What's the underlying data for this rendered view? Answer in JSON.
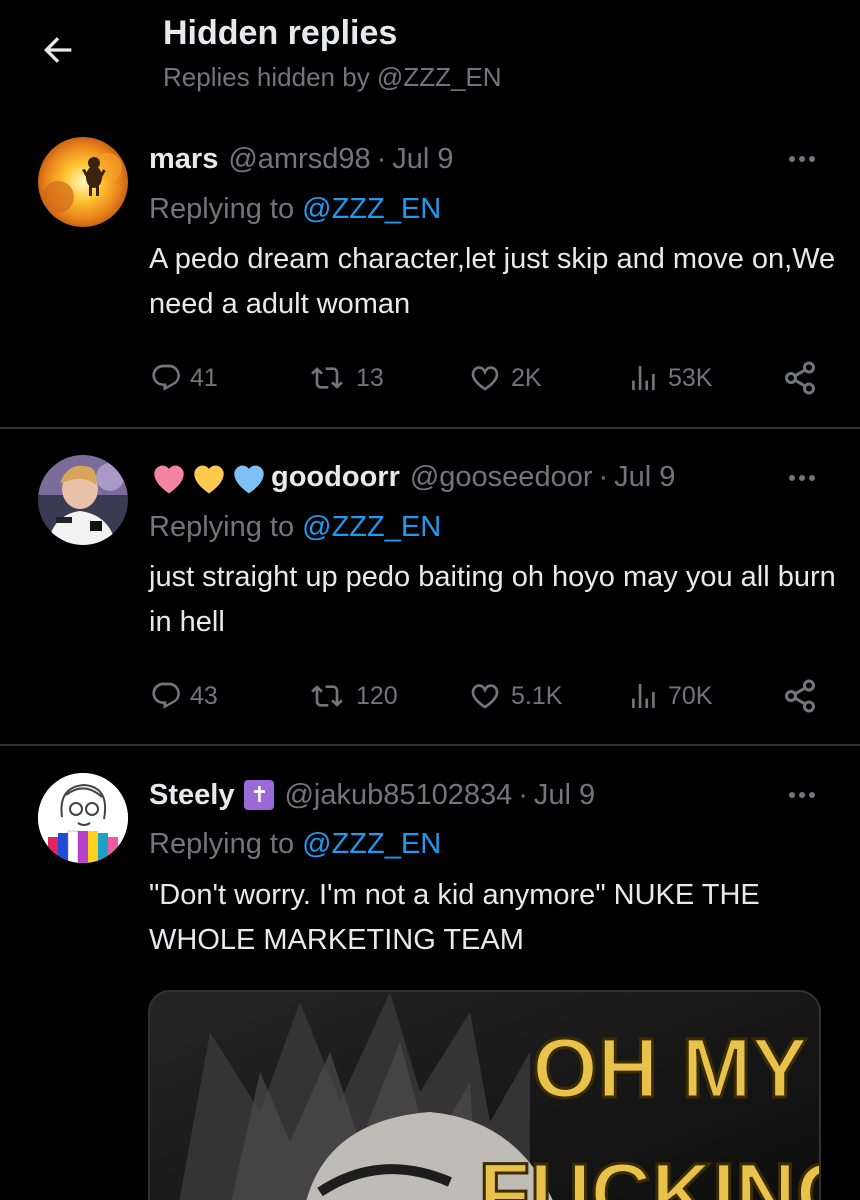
{
  "header": {
    "title": "Hidden replies",
    "subtitle": "Replies hidden by @ZZZ_EN"
  },
  "tweets": [
    {
      "name": "mars",
      "handle": "@amrsd98",
      "separator": "·",
      "date": "Jul 9",
      "replying_prefix": "Replying to",
      "replying_to": "@ZZZ_EN",
      "text": "A pedo dream character,let just skip and move on,We need a adult woman",
      "replies": "41",
      "reposts": "13",
      "likes": "2K",
      "views": "53K"
    },
    {
      "name": "goodoorr",
      "handle": "@gooseedoor",
      "separator": "·",
      "date": "Jul 9",
      "replying_prefix": "Replying to",
      "replying_to": "@ZZZ_EN",
      "text": "just straight up pedo baiting oh hoyo may you all burn in hell",
      "replies": "43",
      "reposts": "120",
      "likes": "5.1K",
      "views": "70K",
      "name_emoji_colors": [
        "#f4849f",
        "#ffc94d",
        "#7ec0f5"
      ]
    },
    {
      "name": "Steely",
      "handle": "@jakub85102834",
      "separator": "·",
      "date": "Jul 9",
      "replying_prefix": "Replying to",
      "replying_to": "@ZZZ_EN",
      "text": "\"Don't worry. I'm not a kid anymore\" NUKE THE WHOLE MARKETING TEAM",
      "badge": "✝",
      "media_caption_line1": "OH MY",
      "media_caption_line2": "FUCKING"
    }
  ],
  "colors": {
    "background": "#000000",
    "text_primary": "#e7e9ea",
    "text_secondary": "#71767b",
    "accent": "#1d9bf0",
    "divider": "#2f3336"
  },
  "icons": [
    "back-arrow-icon",
    "more-icon",
    "reply-icon",
    "repost-icon",
    "like-icon",
    "views-icon",
    "share-icon"
  ]
}
